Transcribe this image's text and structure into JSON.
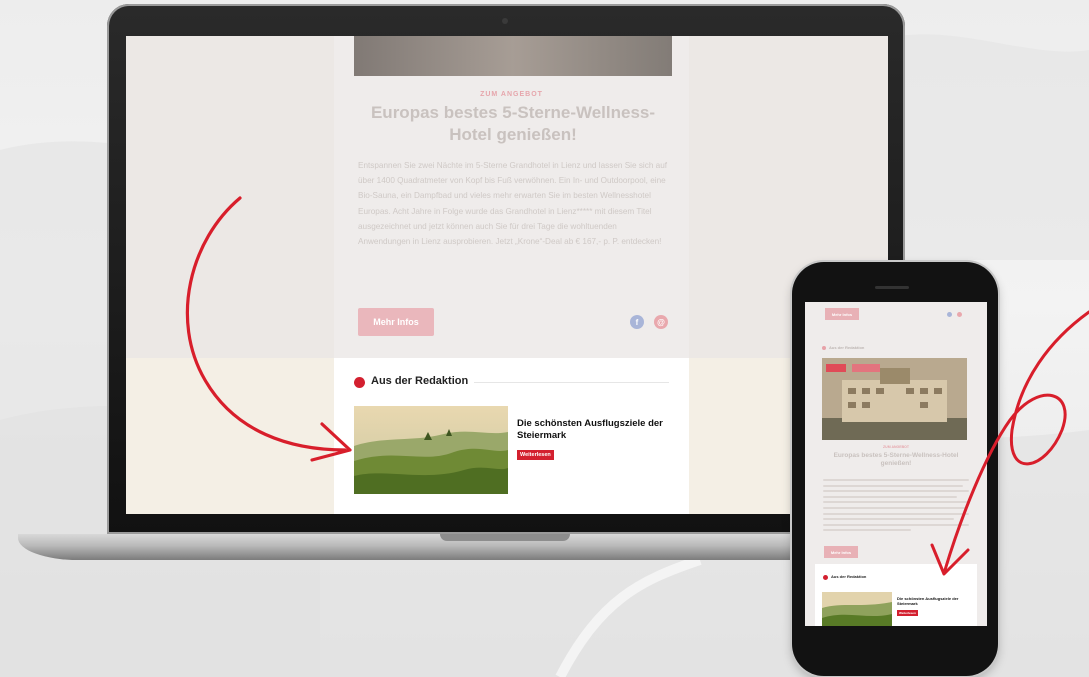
{
  "colors": {
    "accent_red": "#d3202f",
    "pale_pink": "#e8b1b6",
    "beige_band": "#f4efe5",
    "arrow_red": "#d81e2b"
  },
  "laptop": {
    "newsletter": {
      "tag": "ZUM ANGEBOT",
      "title": "Europas bestes 5-Sterne-Wellness-Hotel genießen!",
      "body": "Entspannen Sie zwei Nächte im 5-Sterne Grandhotel in Lienz und lassen Sie sich auf über 1400 Quadratmeter von Kopf bis Fuß verwöhnen. Ein In- und Outdoorpool, eine Bio-Sauna, ein Dampfbad und vieles mehr erwarten Sie im besten Wellnesshotel Europas. Acht Jahre in Folge wurde das Grandhotel in Lienz***** mit diesem Titel ausgezeichnet und jetzt können auch Sie für drei Tage die wohltuenden Anwendungen in Lienz ausprobieren. Jetzt „Krone“-Deal ab € 167,- p. P. entdecken!",
      "more_button": "Mehr Infos",
      "social_icons": [
        "facebook-icon",
        "mail-icon"
      ]
    },
    "editorial": {
      "section_label": "Aus der Redaktion",
      "article_title": "Die schönsten Ausflugsziele der Steiermark",
      "article_link": "Weiterlesen"
    }
  },
  "phone": {
    "top_button": "Mehr Infos",
    "section_label": "Aus der Redaktion",
    "newsletter_tag": "ZUM ANGEBOT",
    "newsletter_title": "Europas bestes 5-Sterne-Wellness-Hotel genießen!",
    "more_button": "Mehr Infos",
    "editorial_label": "Aus der Redaktion",
    "article_title": "Die schönsten Ausflugsziele der Steiermark",
    "article_link": "Weiterlesen"
  }
}
